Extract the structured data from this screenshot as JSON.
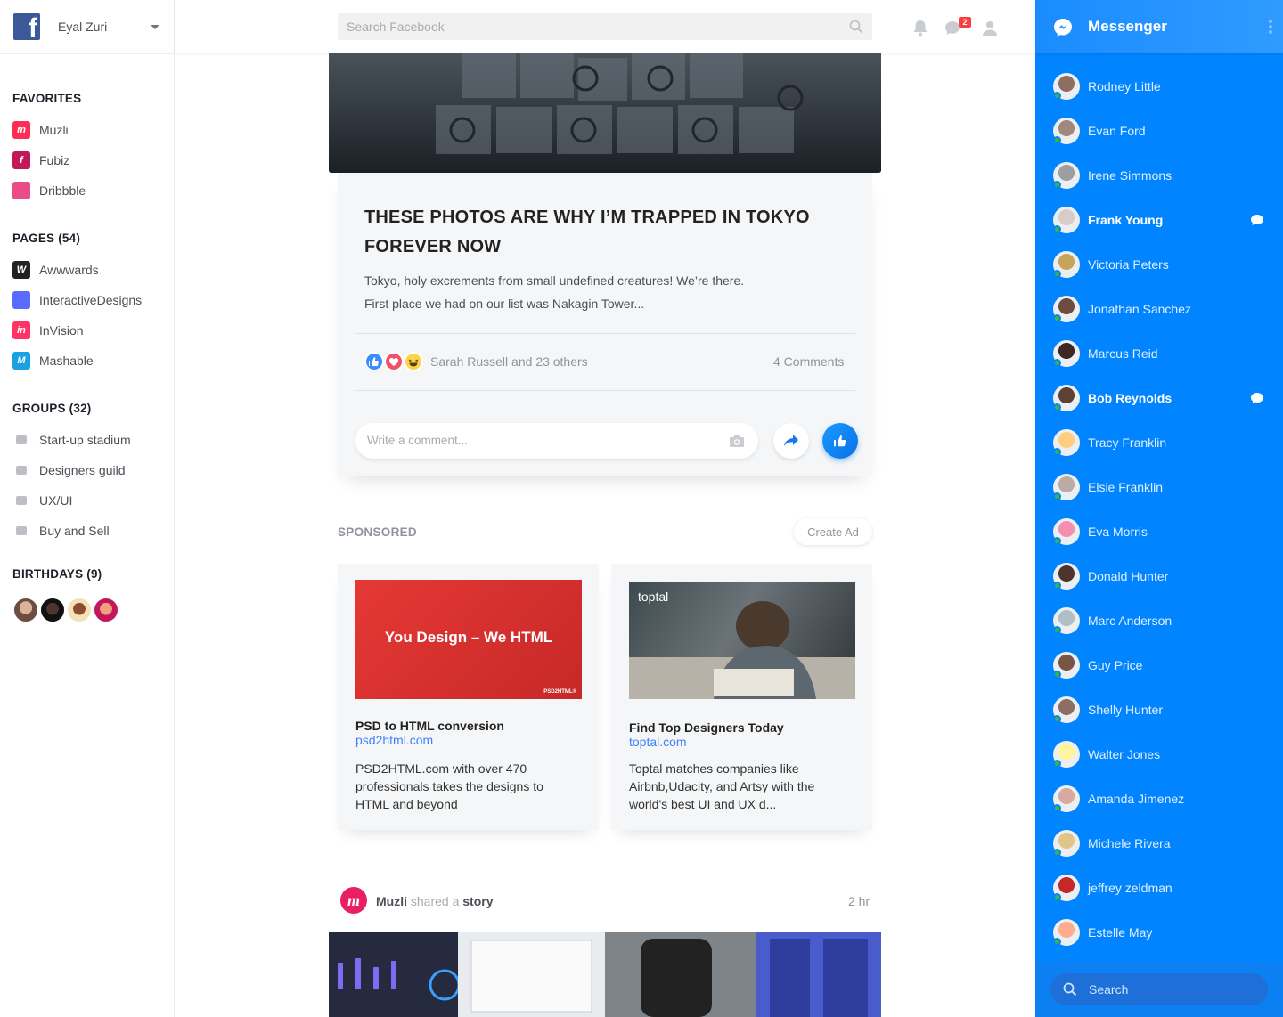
{
  "topbar": {
    "user_name": "Eyal Zuri",
    "search_placeholder": "Search Facebook",
    "notification_count": "2"
  },
  "sidebar": {
    "favorites_title": "FAVORITES",
    "favorites": [
      {
        "label": "Muzli",
        "icon": "muzli-icon",
        "color": "#ff2d55",
        "glyph": "m"
      },
      {
        "label": "Fubiz",
        "icon": "fubiz-icon",
        "color": "#c2185b",
        "glyph": "f"
      },
      {
        "label": "Dribbble",
        "icon": "dribbble-icon",
        "color": "#ea4c89",
        "glyph": ""
      }
    ],
    "pages_title": "PAGES (54)",
    "pages": [
      {
        "label": "Awwwards",
        "icon": "awwwards-icon",
        "color": "#222222",
        "glyph": "W"
      },
      {
        "label": "InteractiveDesigns",
        "icon": "interactivedesigns-icon",
        "color": "#5b6bff",
        "glyph": ""
      },
      {
        "label": "InVision",
        "icon": "invision-icon",
        "color": "#ff3366",
        "glyph": "in"
      },
      {
        "label": "Mashable",
        "icon": "mashable-icon",
        "color": "#1ba1e2",
        "glyph": "M"
      }
    ],
    "groups_title": "GROUPS (32)",
    "groups": [
      {
        "label": "Start-up stadium",
        "icon": "lightbulb-icon"
      },
      {
        "label": "Designers guild",
        "icon": "puzzle-icon"
      },
      {
        "label": "UX/UI",
        "icon": "server-icon"
      },
      {
        "label": "Buy and Sell",
        "icon": "basket-icon"
      }
    ],
    "birthdays_title": "BIRTHDAYS (9)"
  },
  "post": {
    "title": "THESE PHOTOS ARE WHY I’M TRAPPED IN TOKYO FOREVER NOW",
    "body_line1": "Tokyo, holy excrements from small undefined creatures! We’re there.",
    "body_line2": "First place we had on our list was Nakagin Tower...",
    "reactions_text": "Sarah Russell and 23 others",
    "comments_count": "4 Comments",
    "comment_placeholder": "Write a comment..."
  },
  "sponsored": {
    "title": "SPONSORED",
    "create_ad": "Create Ad",
    "ads": [
      {
        "banner_text": "You Design – We HTML",
        "banner_brand": "PSD2HTML®",
        "title": "PSD to HTML conversion",
        "link": "psd2html.com",
        "text": "PSD2HTML.com with over 470 professionals takes the designs to HTML and beyond"
      },
      {
        "banner_brand": "toptal",
        "title": "Find Top Designers Today",
        "link": "toptal.com",
        "text": "Toptal matches companies like Airbnb,Udacity, and Artsy with the world's best UI and UX d..."
      }
    ]
  },
  "story": {
    "author": "Muzli",
    "shared": "shared a",
    "object": "story",
    "time": "2 hr"
  },
  "messenger": {
    "title": "Messenger",
    "search_placeholder": "Search",
    "contacts": [
      {
        "name": "Rodney Little",
        "unread": false,
        "color": "#8d6e63"
      },
      {
        "name": "Evan Ford",
        "unread": false,
        "color": "#a1887f"
      },
      {
        "name": "Irene Simmons",
        "unread": false,
        "color": "#9e9e9e"
      },
      {
        "name": "Frank Young",
        "unread": true,
        "color": "#d7ccc8"
      },
      {
        "name": "Victoria Peters",
        "unread": false,
        "color": "#c8a35a"
      },
      {
        "name": "Jonathan Sanchez",
        "unread": false,
        "color": "#6d4c41"
      },
      {
        "name": "Marcus Reid",
        "unread": false,
        "color": "#3e2723"
      },
      {
        "name": "Bob Reynolds",
        "unread": true,
        "color": "#5d4037"
      },
      {
        "name": "Tracy Franklin",
        "unread": false,
        "color": "#ffcc80"
      },
      {
        "name": "Elsie Franklin",
        "unread": false,
        "color": "#bcaaa4"
      },
      {
        "name": "Eva Morris",
        "unread": false,
        "color": "#f48fb1"
      },
      {
        "name": "Donald Hunter",
        "unread": false,
        "color": "#4e342e"
      },
      {
        "name": "Marc Anderson",
        "unread": false,
        "color": "#b0bec5"
      },
      {
        "name": "Guy Price",
        "unread": false,
        "color": "#795548"
      },
      {
        "name": "Shelly Hunter",
        "unread": false,
        "color": "#8d6e63"
      },
      {
        "name": "Walter Jones",
        "unread": false,
        "color": "#fff59d"
      },
      {
        "name": "Amanda Jimenez",
        "unread": false,
        "color": "#d7a9a0"
      },
      {
        "name": "Michele Rivera",
        "unread": false,
        "color": "#e0c58b"
      },
      {
        "name": "jeffrey zeldman",
        "unread": false,
        "color": "#c62828"
      },
      {
        "name": "Estelle May",
        "unread": false,
        "color": "#ffab91"
      }
    ]
  }
}
